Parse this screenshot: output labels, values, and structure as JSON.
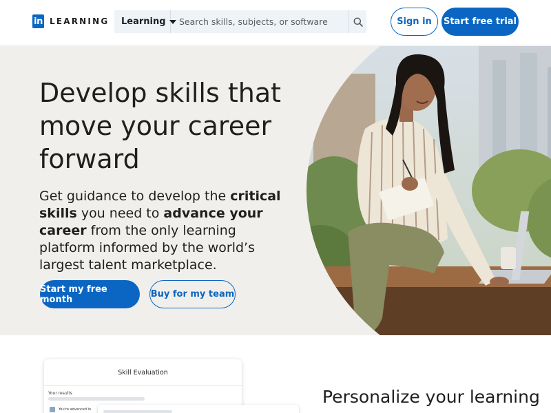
{
  "header": {
    "logo_mark": "in",
    "logo_text": "LEARNING",
    "search": {
      "category_selected": "Learning",
      "placeholder": "Search skills, subjects, or software"
    },
    "sign_in_label": "Sign in",
    "start_trial_label": "Start free trial"
  },
  "hero": {
    "title": "Develop skills that move your career forward",
    "subtitle_parts": {
      "p1": "Get guidance to develop the ",
      "b1": "critical skills",
      "p2": " you need to ",
      "b2": "advance your career",
      "p3": " from the only learning platform informed by the world’s largest talent marketplace."
    },
    "primary_cta": "Start my free month",
    "secondary_cta": "Buy for my team"
  },
  "preview_card": {
    "title": "Skill Evaluation",
    "results_label": "Your results",
    "advanced_label": "You're advanced in"
  },
  "section": {
    "title": "Personalize your learning"
  },
  "colors": {
    "brand_blue": "#0a66c2",
    "hero_bg": "#f1efeb"
  }
}
